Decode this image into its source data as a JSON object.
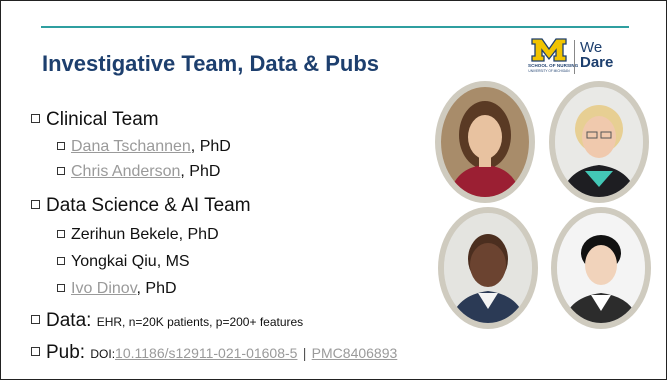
{
  "slide": {
    "title": "Investigative Team, Data & Pubs",
    "logo": {
      "school_text": "SCHOOL OF NURSING",
      "university_text": "UNIVERSITY OF MICHIGAN",
      "we": "We",
      "dare": "Dare"
    },
    "clinical_team": {
      "label": "Clinical Team",
      "members": [
        {
          "name": "Dana Tschannen",
          "suffix": ", PhD"
        },
        {
          "name": "Chris Anderson",
          "suffix": ", PhD"
        }
      ]
    },
    "data_science_team": {
      "label": "Data Science & AI Team",
      "members": [
        {
          "name": "Zerihun Bekele, PhD"
        },
        {
          "name": "Yongkai Qiu, MS"
        },
        {
          "name": "Ivo Dinov",
          "suffix": ", PhD"
        }
      ]
    },
    "data_line": {
      "label": "Data:",
      "detail": "EHR, n=20K patients, p=200+ features"
    },
    "pub_line": {
      "label": "Pub:",
      "doi_label": "DOI:",
      "doi": "10.1186/s12911-021-01608-5",
      "separator": "|",
      "pmc": "PMC8406893"
    },
    "colors": {
      "title": "#1d3f6e",
      "accent_rule": "#2f9fa0",
      "link": "#9a9a9a",
      "photo_frame": "#cfcbbf",
      "logo_maize": "#f1c400"
    }
  }
}
